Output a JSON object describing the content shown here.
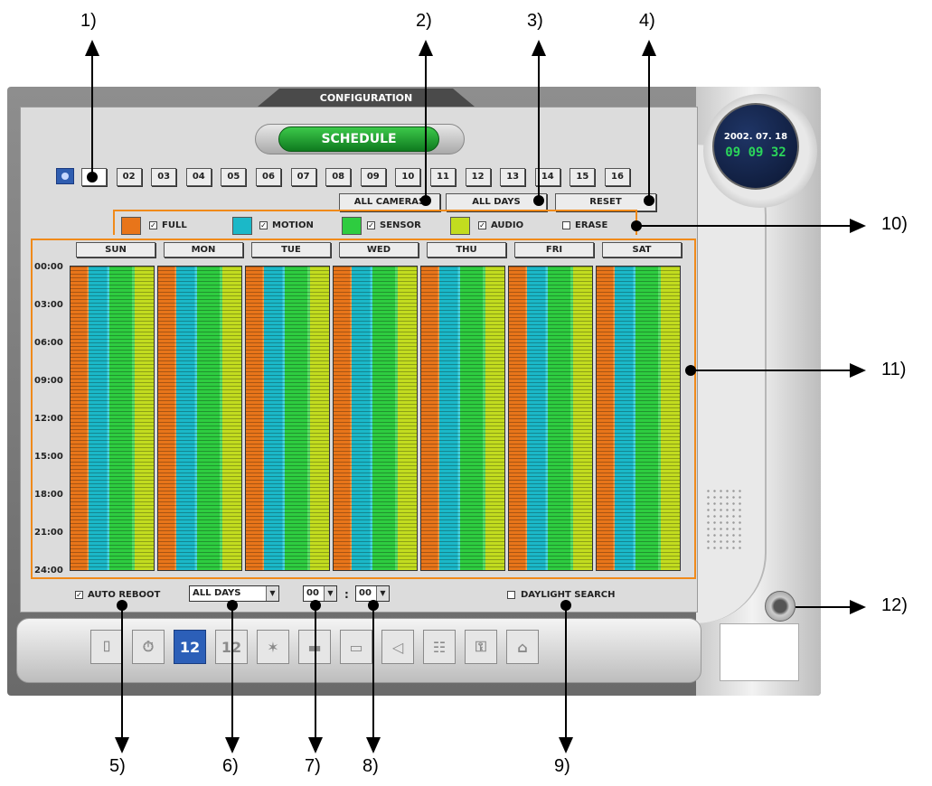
{
  "window": {
    "title": "CONFIGURATION",
    "section": "SCHEDULE"
  },
  "camera_tabs": [
    "",
    "02",
    "03",
    "04",
    "05",
    "06",
    "07",
    "08",
    "09",
    "10",
    "11",
    "12",
    "13",
    "14",
    "15",
    "16"
  ],
  "buttons": {
    "all_cameras": "ALL CAMERAS",
    "all_days": "ALL DAYS",
    "reset": "RESET"
  },
  "legend": [
    {
      "label": "FULL",
      "color": "#e8751a",
      "checked": true
    },
    {
      "label": "MOTION",
      "color": "#1bb8c8",
      "checked": true
    },
    {
      "label": "SENSOR",
      "color": "#2ecc40",
      "checked": true
    },
    {
      "label": "AUDIO",
      "color": "#c2dc1f",
      "checked": true
    },
    {
      "label": "ERASE",
      "color": null,
      "checked": false
    }
  ],
  "days": [
    "SUN",
    "MON",
    "TUE",
    "WED",
    "THU",
    "FRI",
    "SAT"
  ],
  "times": [
    "00:00",
    "03:00",
    "06:00",
    "09:00",
    "12:00",
    "15:00",
    "18:00",
    "21:00",
    "24:00"
  ],
  "bottom": {
    "auto_reboot_label": "AUTO REBOOT",
    "auto_reboot_checked": true,
    "reboot_day": "ALL DAYS",
    "reboot_hour": "00",
    "time_separator": ":",
    "reboot_minute": "00",
    "daylight_label": "DAYLIGHT SEARCH",
    "daylight_checked": false
  },
  "toolbar": [
    "camera-icon",
    "clock-icon",
    "schedule-icon",
    "schedule-copy-icon",
    "motion-icon",
    "clapboard-icon",
    "monitor-icon",
    "speaker-icon",
    "network-icon",
    "key-icon",
    "user-icon"
  ],
  "clock": {
    "date": "2002. 07. 18",
    "time": "09 09 32"
  },
  "callouts": [
    "1)",
    "2)",
    "3)",
    "4)",
    "5)",
    "6)",
    "7)",
    "8)",
    "9)",
    "10)",
    "11)",
    "12)"
  ]
}
